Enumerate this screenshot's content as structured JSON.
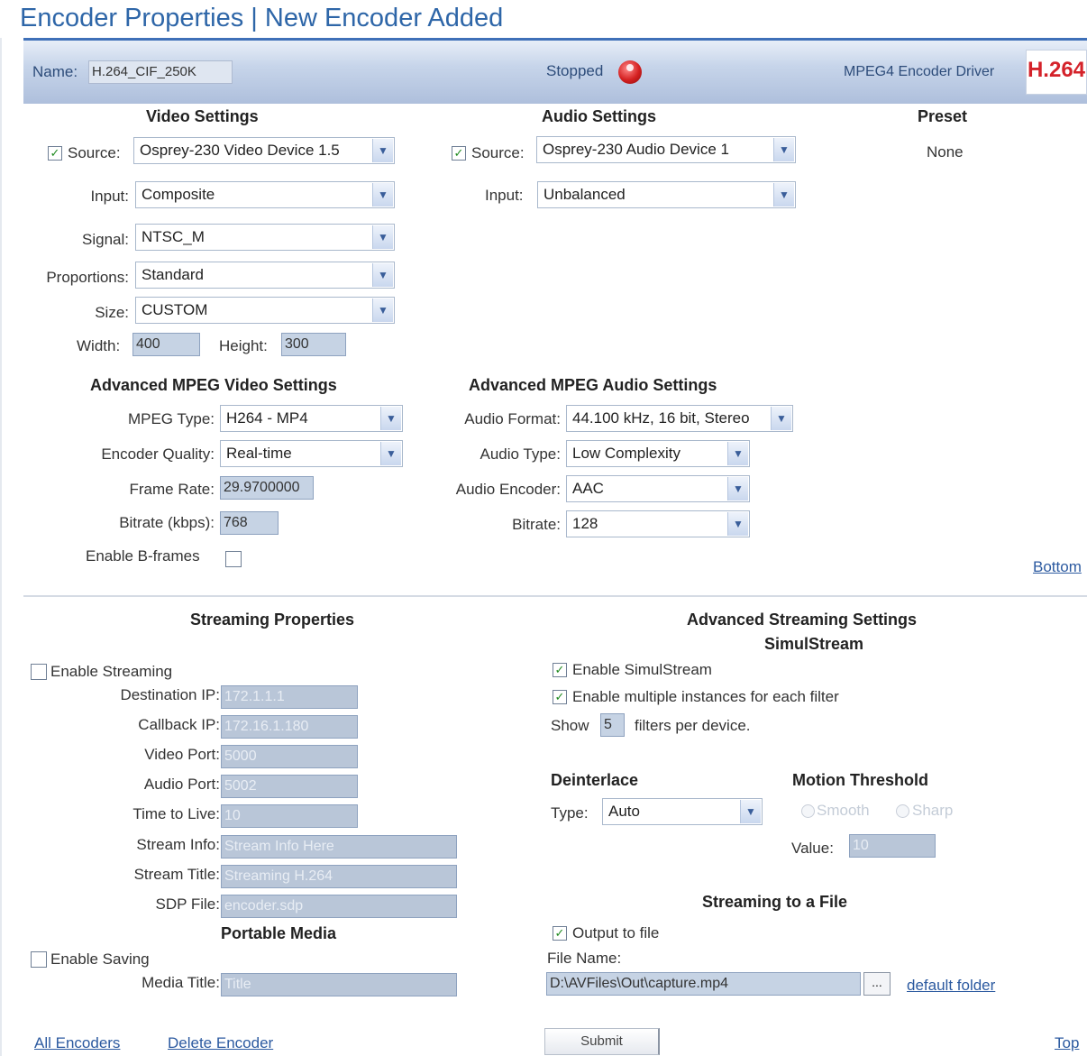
{
  "page_title": "Encoder Properties | New Encoder Added",
  "header": {
    "name_label": "Name:",
    "name_value": "H.264_CIF_250K",
    "status": "Stopped",
    "driver": "MPEG4 Encoder Driver",
    "logo_text": "H.264",
    "status_color": "#d42020"
  },
  "video": {
    "title": "Video Settings",
    "source_label": "Source:",
    "source_value": "Osprey-230 Video Device 1.5",
    "input_label": "Input:",
    "input_value": "Composite",
    "signal_label": "Signal:",
    "signal_value": "NTSC_M",
    "proportions_label": "Proportions:",
    "proportions_value": "Standard",
    "size_label": "Size:",
    "size_value": "CUSTOM",
    "width_label": "Width:",
    "width_value": "400",
    "height_label": "Height:",
    "height_value": "300"
  },
  "audio": {
    "title": "Audio Settings",
    "source_label": "Source:",
    "source_value": "Osprey-230 Audio Device 1",
    "input_label": "Input:",
    "input_value": "Unbalanced"
  },
  "preset": {
    "title": "Preset",
    "value": "None"
  },
  "adv_video": {
    "title": "Advanced MPEG Video Settings",
    "mpeg_type_label": "MPEG Type:",
    "mpeg_type_value": "H264 - MP4",
    "quality_label": "Encoder Quality:",
    "quality_value": "Real-time",
    "frame_rate_label": "Frame Rate:",
    "frame_rate_value": "29.9700000",
    "bitrate_label": "Bitrate (kbps):",
    "bitrate_value": "768",
    "bframes_label": "Enable B-frames"
  },
  "adv_audio": {
    "title": "Advanced MPEG Audio Settings",
    "format_label": "Audio Format:",
    "format_value": "44.100 kHz, 16 bit, Stereo",
    "type_label": "Audio Type:",
    "type_value": "Low Complexity",
    "encoder_label": "Audio Encoder:",
    "encoder_value": "AAC",
    "bitrate_label": "Bitrate:",
    "bitrate_value": "128"
  },
  "bottom_link": "Bottom",
  "streaming": {
    "title": "Streaming Properties",
    "enable_label": "Enable Streaming",
    "dest_ip_label": "Destination IP:",
    "dest_ip_value": "172.1.1.1",
    "callback_ip_label": "Callback IP:",
    "callback_ip_value": "172.16.1.180",
    "video_port_label": "Video Port:",
    "video_port_value": "5000",
    "audio_port_label": "Audio Port:",
    "audio_port_value": "5002",
    "ttl_label": "Time to Live:",
    "ttl_value": "10",
    "stream_info_label": "Stream Info:",
    "stream_info_value": "Stream Info Here",
    "stream_title_label": "Stream Title:",
    "stream_title_value": "Streaming H.264",
    "sdp_label": "SDP File:",
    "sdp_value": "encoder.sdp"
  },
  "portable": {
    "title": "Portable Media",
    "enable_label": "Enable Saving",
    "media_title_label": "Media Title:",
    "media_title_value": "Title"
  },
  "adv_stream": {
    "title": "Advanced Streaming Settings",
    "subtitle": "SimulStream",
    "simul_label": "Enable SimulStream",
    "multi_label": "Enable multiple instances for each filter",
    "show_label": "Show",
    "show_value": "5",
    "filters_label": "filters per device."
  },
  "deinterlace": {
    "title": "Deinterlace",
    "type_label": "Type:",
    "type_value": "Auto"
  },
  "motion": {
    "title": "Motion Threshold",
    "smooth_label": "Smooth",
    "sharp_label": "Sharp",
    "value_label": "Value:",
    "value_value": "10"
  },
  "file_stream": {
    "title": "Streaming to a File",
    "output_label": "Output to file",
    "file_name_label": "File Name:",
    "file_name_value": "D:\\AVFiles\\Out\\capture.mp4",
    "browse_label": "...",
    "default_folder_link": "default folder"
  },
  "footer": {
    "all_encoders": "All Encoders",
    "delete_encoder": "Delete Encoder",
    "submit": "Submit",
    "top": "Top"
  }
}
